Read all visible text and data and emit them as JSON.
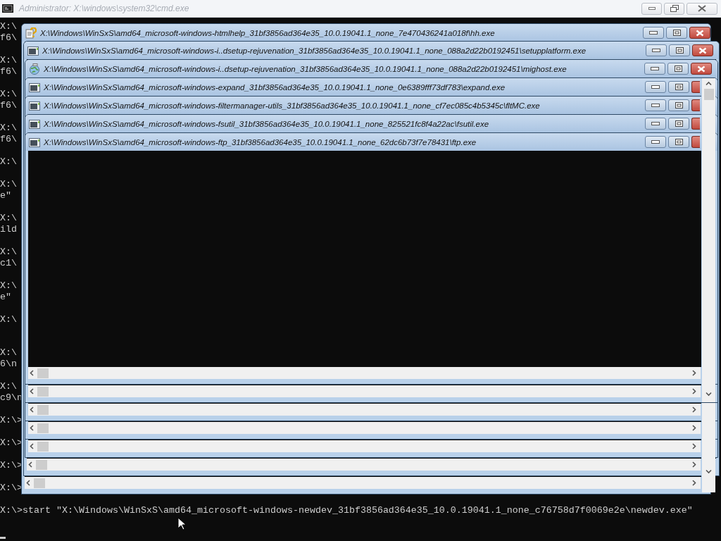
{
  "console_window": {
    "title": "Administrator: X:\\windows\\system32\\cmd.exe"
  },
  "console_upper_blocks": [
    {
      "lines": [
        "X:\\",
        "f6\\"
      ]
    },
    {
      "lines": [
        "X:\\",
        "f6\\"
      ]
    },
    {
      "lines": [
        "X:\\",
        "f6\\"
      ]
    },
    {
      "lines": [
        "X:\\",
        "f6\\"
      ]
    },
    {
      "lines": [
        "X:\\"
      ]
    },
    {
      "lines": [
        "X:\\",
        "e\""
      ]
    },
    {
      "lines": [
        "X:\\",
        "ild"
      ]
    },
    {
      "lines": [
        "X:\\",
        "c1\\"
      ]
    },
    {
      "lines": [
        "X:\\",
        "e\""
      ]
    },
    {
      "lines": [
        "X:\\"
      ]
    }
  ],
  "console_lower_blocks": [
    {
      "lines": [
        "X:\\",
        "6\\n"
      ]
    },
    {
      "lines": [
        "X:\\",
        "c9\\n"
      ]
    },
    {
      "lines": [
        "X:\\>"
      ]
    },
    {
      "lines": [
        "X:\\>"
      ]
    },
    {
      "lines": [
        "X:\\>"
      ]
    },
    {
      "lines": [
        "X:\\>"
      ]
    },
    {
      "lines": [
        "X:\\>start \"X:\\Windows\\WinSxS\\amd64_microsoft-windows-newdev_31bf3856ad364e35_10.0.19041.1_none_c76758d7f0069e2e\\newdev.exe\""
      ]
    }
  ],
  "windows": [
    {
      "title": "X:\\Windows\\WinSxS\\amd64_microsoft-windows-htmlhelp_31bf3856ad364e35_10.0.19041.1_none_7e470436241a018f\\hh.exe",
      "kind": "help"
    },
    {
      "title": "X:\\Windows\\WinSxS\\amd64_microsoft-windows-i..dsetup-rejuvenation_31bf3856ad364e35_10.0.19041.1_none_088a2d22b0192451\\setupplatform.exe",
      "kind": "app"
    },
    {
      "title": "X:\\Windows\\WinSxS\\amd64_microsoft-windows-i..dsetup-rejuvenation_31bf3856ad364e35_10.0.19041.1_none_088a2d22b0192451\\mighost.exe",
      "kind": "globe"
    },
    {
      "title": "X:\\Windows\\WinSxS\\amd64_microsoft-windows-expand_31bf3856ad364e35_10.0.19041.1_none_0e6389fff73df783\\expand.exe",
      "kind": "app"
    },
    {
      "title": "X:\\Windows\\WinSxS\\amd64_microsoft-windows-filtermanager-utils_31bf3856ad364e35_10.0.19041.1_none_cf7ec085c4b5345c\\fltMC.exe",
      "kind": "app"
    },
    {
      "title": "X:\\Windows\\WinSxS\\amd64_microsoft-windows-fsutil_31bf3856ad364e35_10.0.19041.1_none_825521fc8f4a22ac\\fsutil.exe",
      "kind": "app"
    },
    {
      "title": "X:\\Windows\\WinSxS\\amd64_microsoft-windows-ftp_31bf3856ad364e35_10.0.19041.1_none_62dc6b73f7e78431\\ftp.exe",
      "kind": "app"
    }
  ]
}
